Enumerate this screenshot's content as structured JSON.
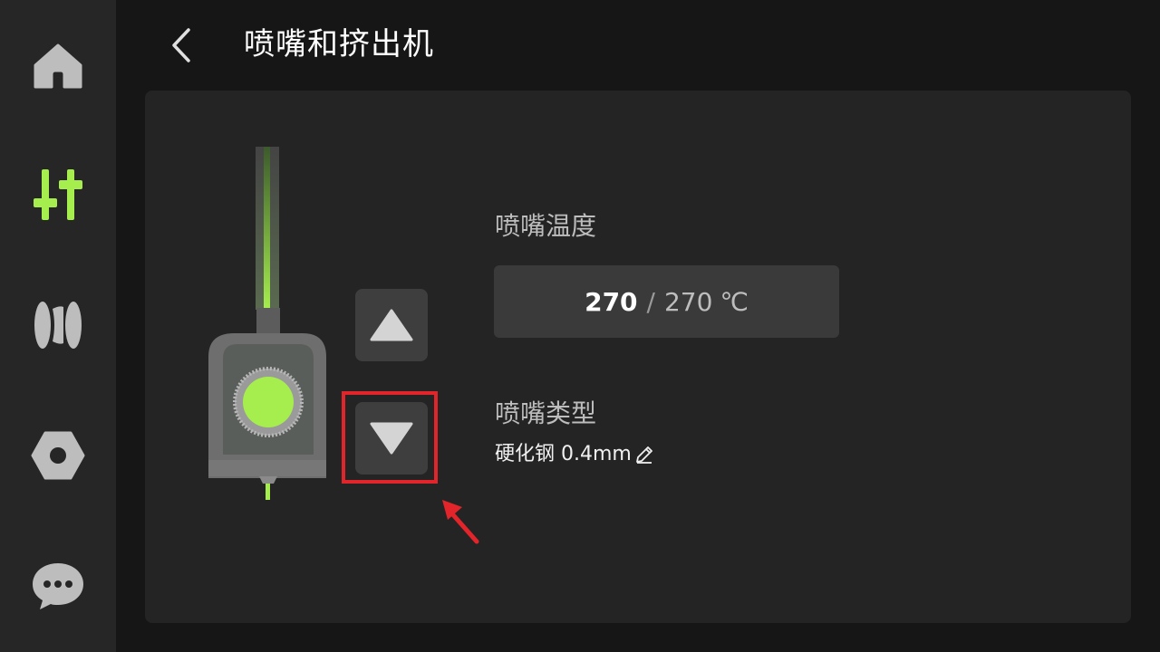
{
  "sidebar": {
    "items": [
      {
        "name": "home",
        "icon": "home-icon",
        "active": false
      },
      {
        "name": "controls",
        "icon": "sliders-icon",
        "active": true
      },
      {
        "name": "filament",
        "icon": "filament-spool-icon",
        "active": false
      },
      {
        "name": "settings",
        "icon": "hex-nut-icon",
        "active": false
      },
      {
        "name": "messages",
        "icon": "chat-bubble-icon",
        "active": false
      }
    ],
    "active_color": "#a6ee4e",
    "inactive_color": "#bdbdbd"
  },
  "header": {
    "back_icon": "chevron-left-icon",
    "title": "喷嘴和挤出机"
  },
  "extruder": {
    "up_icon": "triangle-up-icon",
    "down_icon": "triangle-down-icon",
    "filament_color": "#a6ee4e"
  },
  "nozzle_temperature": {
    "label": "喷嘴温度",
    "current": "270",
    "separator": "/",
    "target": "270",
    "unit": "℃"
  },
  "nozzle_type": {
    "label": "喷嘴类型",
    "value": "硬化钢 0.4mm",
    "edit_icon": "pencil-icon"
  },
  "annotation": {
    "highlight_color": "#e2242b"
  }
}
